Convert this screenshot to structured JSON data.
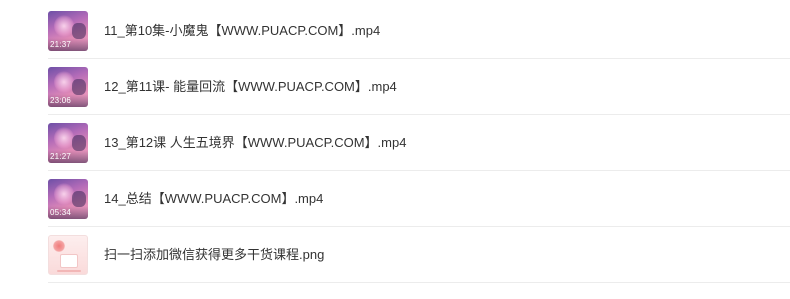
{
  "files": [
    {
      "name": "11_第10集-小魔鬼【WWW.PUACP.COM】.mp4",
      "type": "video",
      "duration": "21:37",
      "thumb_icon": "video-thumbnail-icon"
    },
    {
      "name": "12_第11课- 能量回流【WWW.PUACP.COM】.mp4",
      "type": "video",
      "duration": "23:06",
      "thumb_icon": "video-thumbnail-icon"
    },
    {
      "name": "13_第12课 人生五境界【WWW.PUACP.COM】.mp4",
      "type": "video",
      "duration": "21:27",
      "thumb_icon": "video-thumbnail-icon"
    },
    {
      "name": "14_总结【WWW.PUACP.COM】.mp4",
      "type": "video",
      "duration": "05:34",
      "thumb_icon": "video-thumbnail-icon"
    },
    {
      "name": "扫一扫添加微信获得更多干货课程.png",
      "type": "image",
      "thumb_icon": "image-thumbnail-icon"
    }
  ],
  "colors": {
    "text": "#333333",
    "divider": "#ececec",
    "background": "#ffffff"
  }
}
